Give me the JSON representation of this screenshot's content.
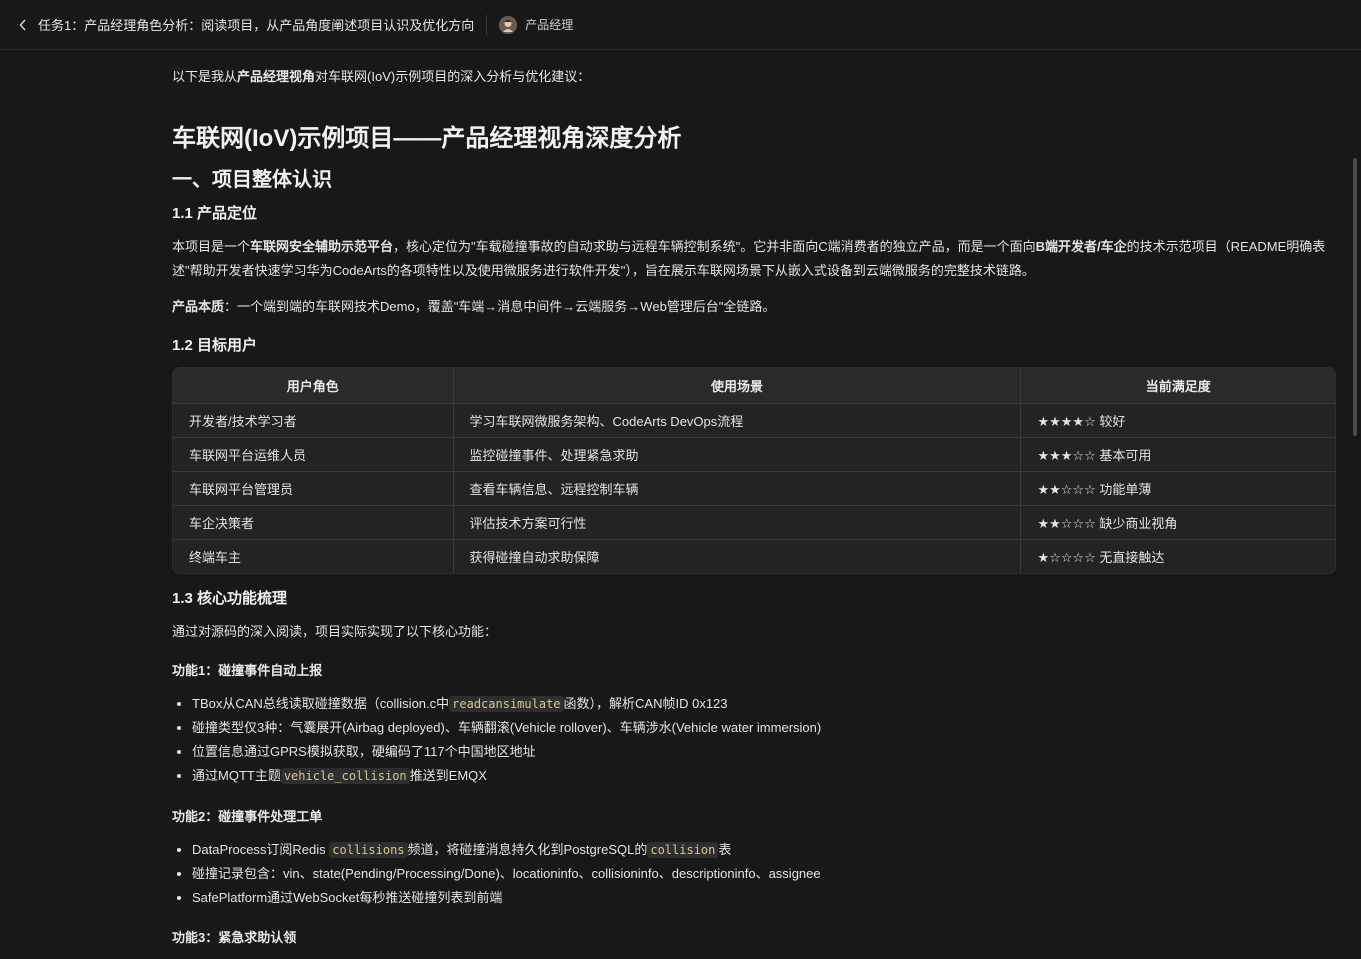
{
  "header": {
    "back_icon": "chevron-left-icon",
    "task_title": "任务1：产品经理角色分析：阅读项目，从产品角度阐述项目认识及优化方向",
    "role_label": "产品经理"
  },
  "intro": {
    "pre": "以下是我从",
    "bold": "产品经理视角",
    "post": "对车联网(IoV)示例项目的深入分析与优化建议："
  },
  "h1": "车联网(IoV)示例项目——产品经理视角深度分析",
  "section1_title": "一、项目整体认识",
  "s11": {
    "title": "1.1 产品定位",
    "p1_a": "本项目是一个",
    "p1_b": "车联网安全辅助示范平台",
    "p1_c": "，核心定位为\"车载碰撞事故的自动求助与远程车辆控制系统\"。它并非面向C端消费者的独立产品，而是一个面向",
    "p1_d": "B端开发者/车企",
    "p1_e": "的技术示范项目（README明确表述\"帮助开发者快速学习华为CodeArts的各项特性以及使用微服务进行软件开发\"），旨在展示车联网场景下从嵌入式设备到云端微服务的完整技术链路。",
    "p2_label": "产品本质",
    "p2_text": "：一个端到端的车联网技术Demo，覆盖\"车端→消息中间件→云端服务→Web管理后台\"全链路。"
  },
  "s12": {
    "title": "1.2 目标用户",
    "headers": [
      "用户角色",
      "使用场景",
      "当前满足度"
    ],
    "rows": [
      [
        "开发者/技术学习者",
        "学习车联网微服务架构、CodeArts DevOps流程",
        "★★★★☆ 较好"
      ],
      [
        "车联网平台运维人员",
        "监控碰撞事件、处理紧急求助",
        "★★★☆☆ 基本可用"
      ],
      [
        "车联网平台管理员",
        "查看车辆信息、远程控制车辆",
        "★★☆☆☆ 功能单薄"
      ],
      [
        "车企决策者",
        "评估技术方案可行性",
        "★★☆☆☆ 缺少商业视角"
      ],
      [
        "终端车主",
        "获得碰撞自动求助保障",
        "★☆☆☆☆ 无直接触达"
      ]
    ]
  },
  "s13": {
    "title": "1.3 核心功能梳理",
    "intro": "通过对源码的深入阅读，项目实际实现了以下核心功能：",
    "f1": {
      "title": "功能1：碰撞事件自动上报",
      "b1_a": "TBox从CAN总线读取碰撞数据（collision.c中",
      "b1_code": "readcansimulate",
      "b1_b": "函数），解析CAN帧ID 0x123",
      "b2": "碰撞类型仅3种：气囊展开(Airbag deployed)、车辆翻滚(Vehicle rollover)、车辆涉水(Vehicle water immersion)",
      "b3": "位置信息通过GPRS模拟获取，硬编码了117个中国地区地址",
      "b4_a": "通过MQTT主题",
      "b4_code": "vehicle_collision",
      "b4_b": "推送到EMQX"
    },
    "f2": {
      "title": "功能2：碰撞事件处理工单",
      "b1_a": "DataProcess订阅Redis ",
      "b1_code1": "collisions",
      "b1_b": "频道，将碰撞消息持久化到PostgreSQL的",
      "b1_code2": "collision",
      "b1_c": "表",
      "b2": "碰撞记录包含：vin、state(Pending/Processing/Done)、locationinfo、collisioninfo、descriptioninfo、assignee",
      "b3": "SafePlatform通过WebSocket每秒推送碰撞列表到前端"
    },
    "f3": {
      "title": "功能3：紧急求助认领"
    }
  }
}
